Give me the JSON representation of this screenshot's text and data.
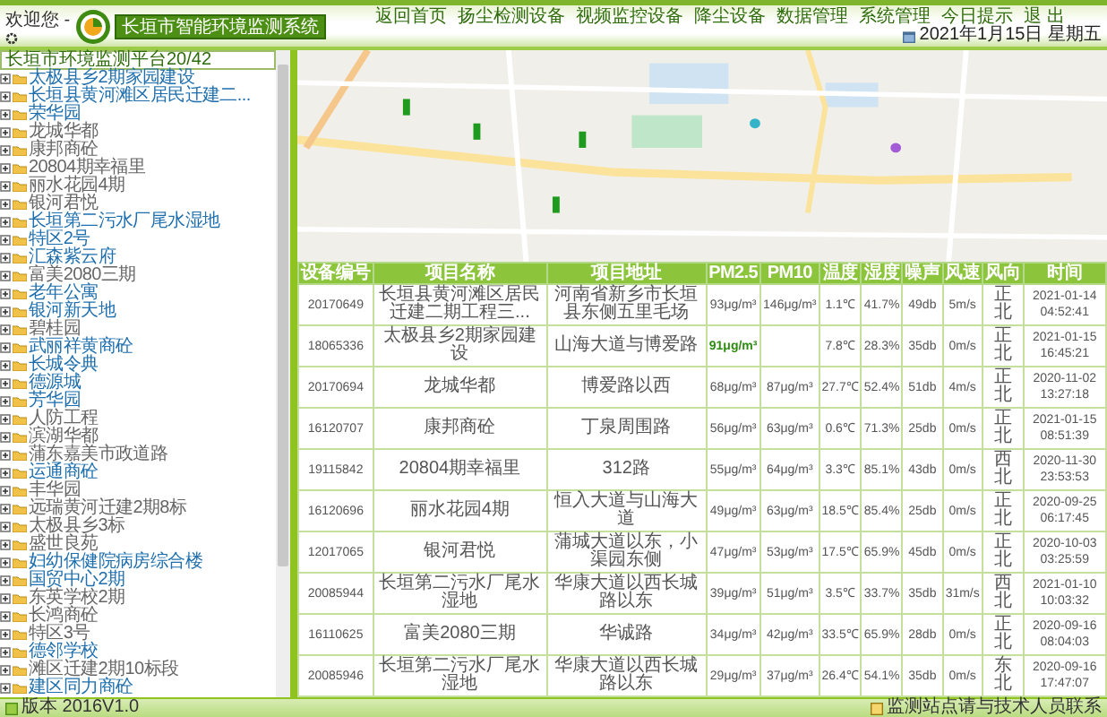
{
  "header": {
    "welcome": "欢迎您 -",
    "title": "长垣市智能环境监测系统",
    "nav": [
      "返回首页",
      "扬尘检测设备",
      "视频监控设备",
      "降尘设备",
      "数据管理",
      "系统管理",
      "今日提示",
      "退 出"
    ],
    "date": "2021年1月15日 星期五"
  },
  "sidebar": {
    "title": "长垣市环境监测平台20/42",
    "items": [
      {
        "label": "太极县乡2期家园建设",
        "online": true
      },
      {
        "label": "长垣县黄河滩区居民迁建二...",
        "online": true
      },
      {
        "label": "荣华园",
        "online": true
      },
      {
        "label": "龙城华都",
        "online": false
      },
      {
        "label": "康邦商砼",
        "online": false
      },
      {
        "label": "20804期幸福里",
        "online": false
      },
      {
        "label": "丽水花园4期",
        "online": false
      },
      {
        "label": "银河君悦",
        "online": false
      },
      {
        "label": "长垣第二污水厂尾水湿地",
        "online": true
      },
      {
        "label": "特区2号",
        "online": true
      },
      {
        "label": "汇森紫云府",
        "online": true
      },
      {
        "label": "富美2080三期",
        "online": false
      },
      {
        "label": "老年公寓",
        "online": true
      },
      {
        "label": "银河新天地",
        "online": true
      },
      {
        "label": "碧桂园",
        "online": false
      },
      {
        "label": "武丽祥黄商砼",
        "online": true
      },
      {
        "label": "长城令典",
        "online": true
      },
      {
        "label": "德源城",
        "online": true
      },
      {
        "label": "芳华园",
        "online": true
      },
      {
        "label": "人防工程",
        "online": false
      },
      {
        "label": "滨湖华都",
        "online": false
      },
      {
        "label": "蒲东嘉美市政道路",
        "online": false
      },
      {
        "label": "运通商砼",
        "online": true
      },
      {
        "label": "丰华园",
        "online": false
      },
      {
        "label": "远瑞黄河迁建2期8标",
        "online": false
      },
      {
        "label": "太极县乡3标",
        "online": false
      },
      {
        "label": "盛世良苑",
        "online": false
      },
      {
        "label": "妇幼保健院病房综合楼",
        "online": true
      },
      {
        "label": "国贸中心2期",
        "online": true
      },
      {
        "label": "东英学校2期",
        "online": false
      },
      {
        "label": "长鸿商砼",
        "online": false
      },
      {
        "label": "特区3号",
        "online": false
      },
      {
        "label": "德邻学校",
        "online": true
      },
      {
        "label": "滩区迁建2期10标段",
        "online": false
      },
      {
        "label": "建区同力商砼",
        "online": true
      }
    ]
  },
  "table": {
    "columns": [
      "设备编号",
      "项目名称",
      "项目地址",
      "PM2.5",
      "PM10",
      "温度",
      "湿度",
      "噪声",
      "风速",
      "风向",
      "时间"
    ],
    "rows": [
      {
        "highlight": false,
        "cells": [
          "20170649",
          "长垣县黄河滩区居民迁建二期工程三...",
          "河南省新乡市长垣县东侧五里毛场",
          "93μg/m³",
          "146μg/m³",
          "1.1℃",
          "41.7%",
          "49db",
          "5m/s",
          "正北",
          "2021-01-14 04:52:41"
        ]
      },
      {
        "highlight": true,
        "cells": [
          "18065336",
          "太极县乡2期家园建设",
          "山海大道与博爱路",
          "91μg/m³",
          "",
          "7.8℃",
          "28.3%",
          "35db",
          "0m/s",
          "正北",
          "2021-01-15 16:45:21"
        ]
      },
      {
        "highlight": false,
        "cells": [
          "20170694",
          "龙城华都",
          "博爱路以西",
          "68μg/m³",
          "87μg/m³",
          "27.7℃",
          "52.4%",
          "51db",
          "4m/s",
          "正北",
          "2020-11-02 13:27:18"
        ]
      },
      {
        "highlight": false,
        "cells": [
          "16120707",
          "康邦商砼",
          "丁泉周围路",
          "56μg/m³",
          "63μg/m³",
          "0.6℃",
          "71.3%",
          "25db",
          "0m/s",
          "正北",
          "2021-01-15 08:51:39"
        ]
      },
      {
        "highlight": false,
        "cells": [
          "19115842",
          "20804期幸福里",
          "312路",
          "55μg/m³",
          "64μg/m³",
          "3.3℃",
          "85.1%",
          "43db",
          "0m/s",
          "西北",
          "2020-11-30 23:53:53"
        ]
      },
      {
        "highlight": false,
        "cells": [
          "16120696",
          "丽水花园4期",
          "恒入大道与山海大道",
          "49μg/m³",
          "63μg/m³",
          "18.5℃",
          "85.4%",
          "25db",
          "0m/s",
          "正北",
          "2020-09-25 06:17:45"
        ]
      },
      {
        "highlight": false,
        "cells": [
          "12017065",
          "银河君悦",
          "蒲城大道以东，小渠园东侧",
          "47μg/m³",
          "53μg/m³",
          "17.5℃",
          "65.9%",
          "45db",
          "0m/s",
          "正北",
          "2020-10-03 03:25:59"
        ]
      },
      {
        "highlight": false,
        "cells": [
          "20085944",
          "长垣第二污水厂尾水湿地",
          "华康大道以西长城路以东",
          "39μg/m³",
          "51μg/m³",
          "3.5℃",
          "33.7%",
          "35db",
          "31m/s",
          "西北",
          "2021-01-10 10:03:32"
        ]
      },
      {
        "highlight": false,
        "cells": [
          "16110625",
          "富美2080三期",
          "华诚路",
          "34μg/m³",
          "42μg/m³",
          "33.5℃",
          "65.9%",
          "28db",
          "0m/s",
          "正北",
          "2020-09-16 08:04:03"
        ]
      },
      {
        "highlight": false,
        "cells": [
          "20085946",
          "长垣第二污水厂尾水湿地",
          "华康大道以西长城路以东",
          "29μg/m³",
          "37μg/m³",
          "26.4℃",
          "54.1%",
          "35db",
          "0m/s",
          "东北",
          "2020-09-16 17:47:07"
        ]
      }
    ]
  },
  "footer": {
    "version": "版本 2016V1.0",
    "notice": "监测站点请与技术人员联系"
  }
}
